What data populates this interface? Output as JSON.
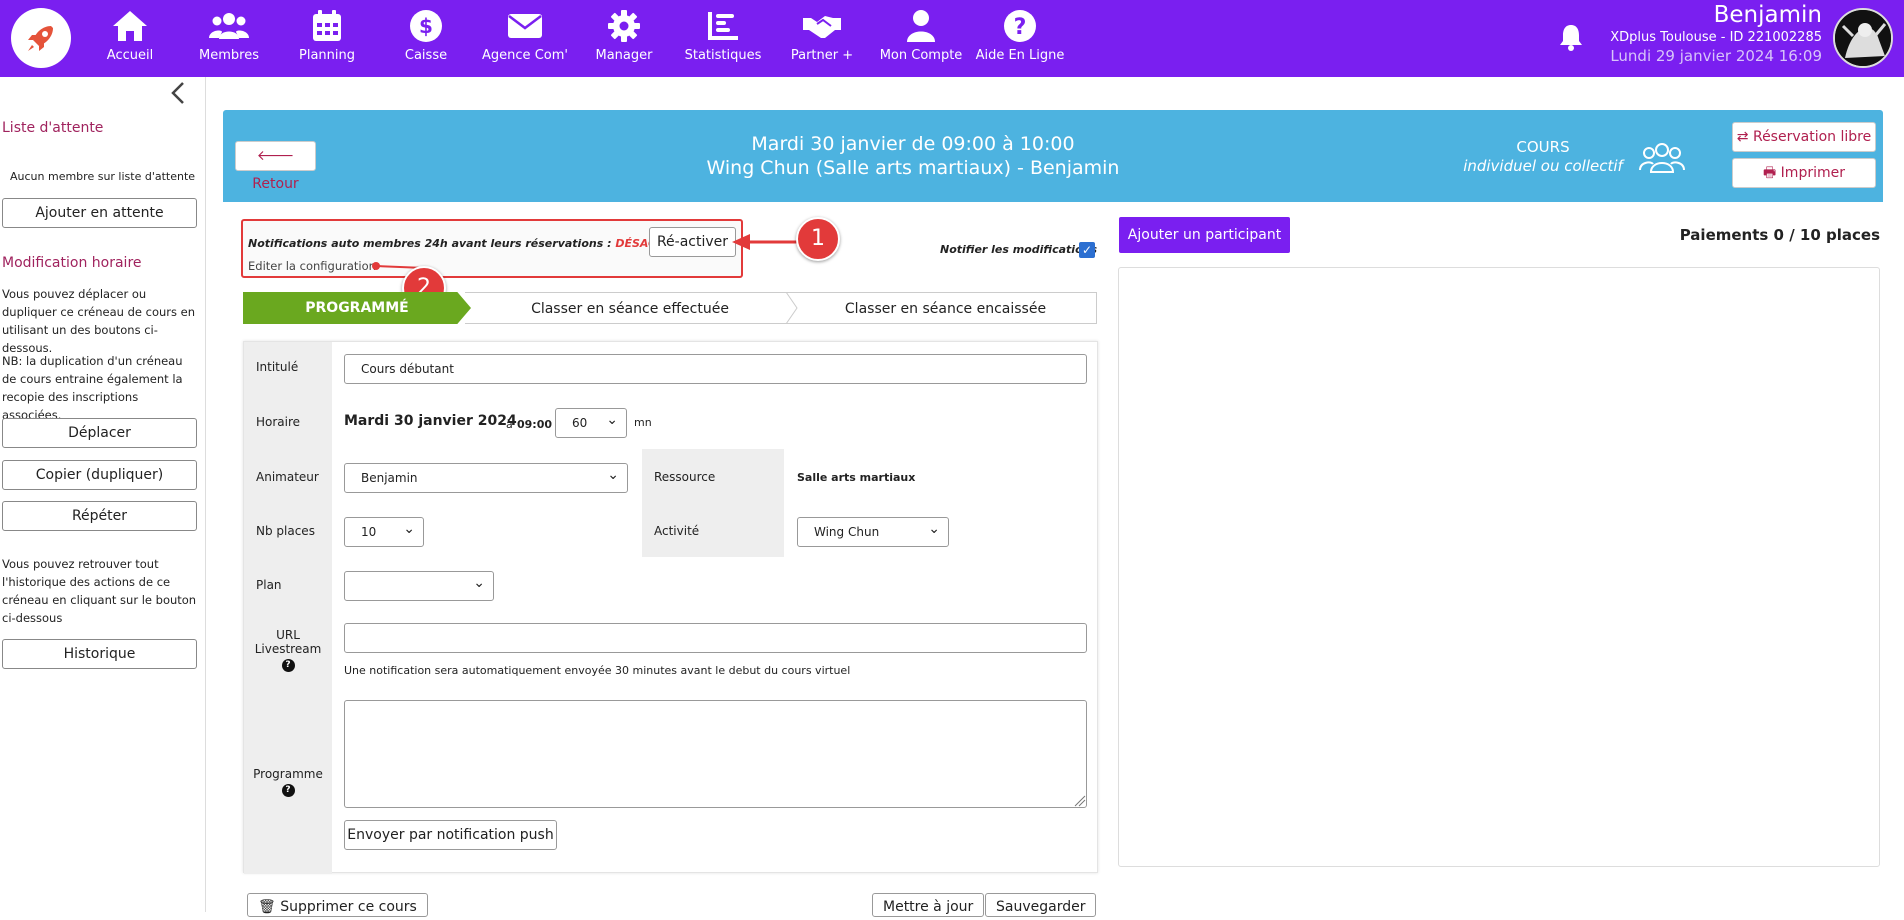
{
  "nav": {
    "items": [
      {
        "label": "Accueil",
        "icon": "home-icon"
      },
      {
        "label": "Membres",
        "icon": "members-icon"
      },
      {
        "label": "Planning",
        "icon": "calendar-icon"
      },
      {
        "label": "Caisse",
        "icon": "dollar-icon"
      },
      {
        "label": "Agence Com'",
        "icon": "mail-icon"
      },
      {
        "label": "Manager",
        "icon": "gear-icon"
      },
      {
        "label": "Statistiques",
        "icon": "chart-icon"
      },
      {
        "label": "Partner +",
        "icon": "handshake-icon"
      },
      {
        "label": "Mon Compte",
        "icon": "user-icon"
      },
      {
        "label": "Aide En Ligne",
        "icon": "help-icon"
      }
    ]
  },
  "user": {
    "name": "Benjamin",
    "club": "XDplus Toulouse - ID 221002285",
    "datetime": "Lundi 29 janvier 2024 16:09"
  },
  "sidebar": {
    "waitlist_title": "Liste d'attente",
    "waitlist_empty": "Aucun membre sur liste d'attente",
    "add_waitlist": "Ajouter en attente",
    "schedule_title": "Modification horaire",
    "schedule_text": "Vous pouvez déplacer ou dupliquer ce créneau de cours en utilisant un des boutons ci-dessous.",
    "schedule_note": "NB: la duplication d'un créneau de cours entraine également la recopie des inscriptions associées.",
    "move": "Déplacer",
    "copy": "Copier (dupliquer)",
    "repeat": "Répéter",
    "history_text": "Vous pouvez retrouver tout l'historique des actions de ce créneau en cliquant sur le bouton ci-dessous",
    "history": "Historique"
  },
  "banner": {
    "back": "Retour",
    "title_line1": "Mardi 30 janvier de 09:00 à 10:00",
    "title_line2": "Wing Chun (Salle arts martiaux) - Benjamin",
    "course_type": "COURS",
    "course_sub": "individuel ou collectif",
    "free_booking": "Réservation libre",
    "print": "Imprimer"
  },
  "notification": {
    "text": "Notifications auto membres 24h avant leurs réservations : ",
    "status": "DÉSACTIVÉE",
    "reactivate": "Ré-activer",
    "edit_config": "Editer la configuration",
    "notify_changes": "Notifier les modifications",
    "notify_checked": true
  },
  "callouts": [
    "1",
    "2"
  ],
  "steps": [
    "PROGRAMMÉ",
    "Classer en séance effectuée",
    "Classer en séance encaissée"
  ],
  "form": {
    "title_label": "Intitulé",
    "title_value": "Cours débutant",
    "time_label": "Horaire",
    "date_value": "Mardi 30 janvier 2024",
    "at": "à",
    "time_value": "09:00",
    "duration_value": "60",
    "duration_unit": "mn",
    "coach_label": "Animateur",
    "coach_value": "Benjamin",
    "resource_label": "Ressource",
    "resource_value": "Salle arts martiaux",
    "places_label": "Nb places",
    "places_value": "10",
    "activity_label": "Activité",
    "activity_value": "Wing Chun",
    "plan_label": "Plan",
    "plan_value": "",
    "url_label_1": "URL",
    "url_label_2": "Livestream",
    "url_value": "",
    "url_help": "Une notification sera automatiquement envoyée 30 minutes avant le debut du cours virtuel",
    "program_label": "Programme",
    "program_value": "",
    "push": "Envoyer par notification push"
  },
  "bottom": {
    "delete": "Supprimer ce cours",
    "update": "Mettre à jour",
    "save": "Sauvegarder"
  },
  "right": {
    "add_participant": "Ajouter un participant",
    "payments": "Paiements 0 / 10 places"
  },
  "colors": {
    "nav_purple": "#7a1ff0",
    "banner_blue": "#4db3e0",
    "accent_red": "#e23a3a",
    "brand_pink": "#b0204f",
    "step_green": "#6aa81f"
  }
}
